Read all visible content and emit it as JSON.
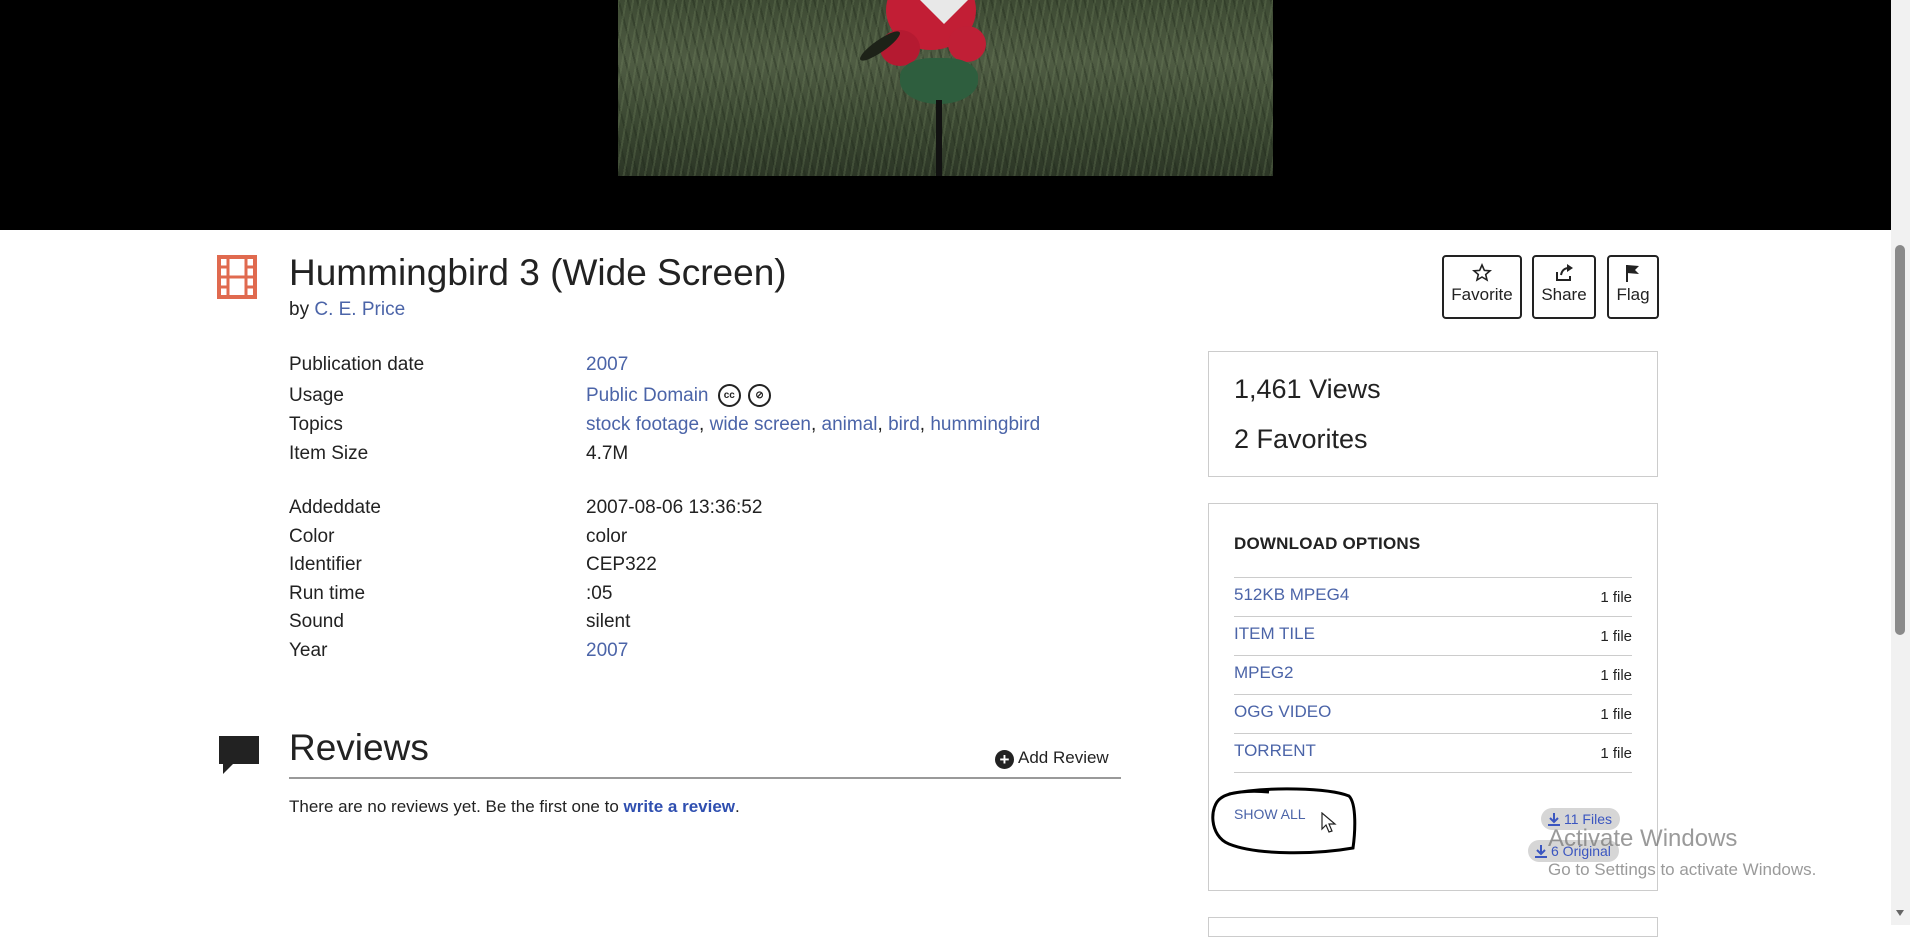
{
  "item": {
    "title": "Hummingbird 3 (Wide Screen)",
    "by_prefix": "by",
    "author": "C. E. Price"
  },
  "actions": {
    "favorite": "Favorite",
    "share": "Share",
    "flag": "Flag"
  },
  "metadata": [
    {
      "label": "Publication date",
      "value": "2007"
    },
    {
      "label": "Usage",
      "value": "Public Domain"
    },
    {
      "label": "Topics",
      "values": [
        "stock footage",
        "wide screen",
        "animal",
        "bird",
        "hummingbird"
      ]
    },
    {
      "label": "Item Size",
      "value": "4.7M"
    },
    {
      "label": "Addeddate",
      "value": "2007-08-06 13:36:52"
    },
    {
      "label": "Color",
      "value": "color"
    },
    {
      "label": "Identifier",
      "value": "CEP322"
    },
    {
      "label": "Run time",
      "value": ":05"
    },
    {
      "label": "Sound",
      "value": "silent"
    },
    {
      "label": "Year",
      "value": "2007"
    }
  ],
  "usage_icons": [
    "cc",
    "pd"
  ],
  "reviews": {
    "title": "Reviews",
    "add_label": "Add Review",
    "empty_text": "There are no reviews yet. Be the first one to ",
    "empty_link": "write a review",
    "empty_end": "."
  },
  "stats": {
    "views": "1,461 Views",
    "favorites": "2 Favorites"
  },
  "downloads": {
    "title": "DOWNLOAD OPTIONS",
    "items": [
      {
        "name": "512KB MPEG4",
        "count": "1 file"
      },
      {
        "name": "ITEM TILE",
        "count": "1 file"
      },
      {
        "name": "MPEG2",
        "count": "1 file"
      },
      {
        "name": "OGG VIDEO",
        "count": "1 file"
      },
      {
        "name": "TORRENT",
        "count": "1 file"
      }
    ],
    "show_all": "SHOW ALL",
    "files_pill": "11 Files",
    "original_pill": "6 Original"
  },
  "watermark": {
    "title": "Activate Windows",
    "subtitle": "Go to Settings to activate Windows."
  },
  "colors": {
    "link": "#4b64a8",
    "film_icon": "#e06a4f"
  }
}
